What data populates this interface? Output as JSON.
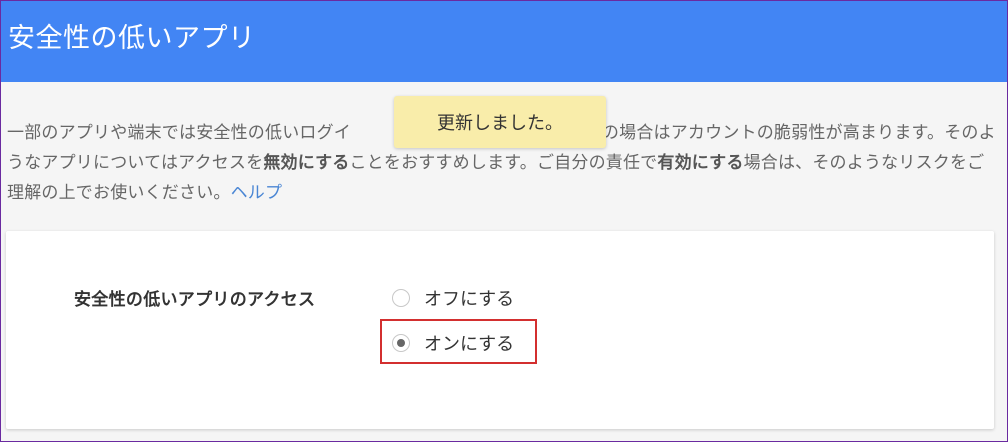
{
  "header": {
    "title": "安全性の低いアプリ"
  },
  "toast": {
    "message": "更新しました。"
  },
  "description": {
    "text_part1": "一部のアプリや端末では安全性の低いログイ",
    "text_part2": "り、その場合はアカウントの脆弱性が高まります。そのようなアプリについてはアクセスを",
    "bold1": "無効にする",
    "text_part3": "ことをおすすめします。ご自分の責任で",
    "bold2": "有効にする",
    "text_part4": "場合は、そのようなリスクをご理解の上でお使いください。",
    "help_link": "ヘルプ"
  },
  "setting": {
    "label": "安全性の低いアプリのアクセス",
    "options": [
      {
        "label": "オフにする",
        "selected": false
      },
      {
        "label": "オンにする",
        "selected": true
      }
    ]
  },
  "colors": {
    "header_bg": "#4285f4",
    "toast_bg": "#f9edaa",
    "highlight_border": "#d32f2f",
    "link": "#4a86d4"
  }
}
